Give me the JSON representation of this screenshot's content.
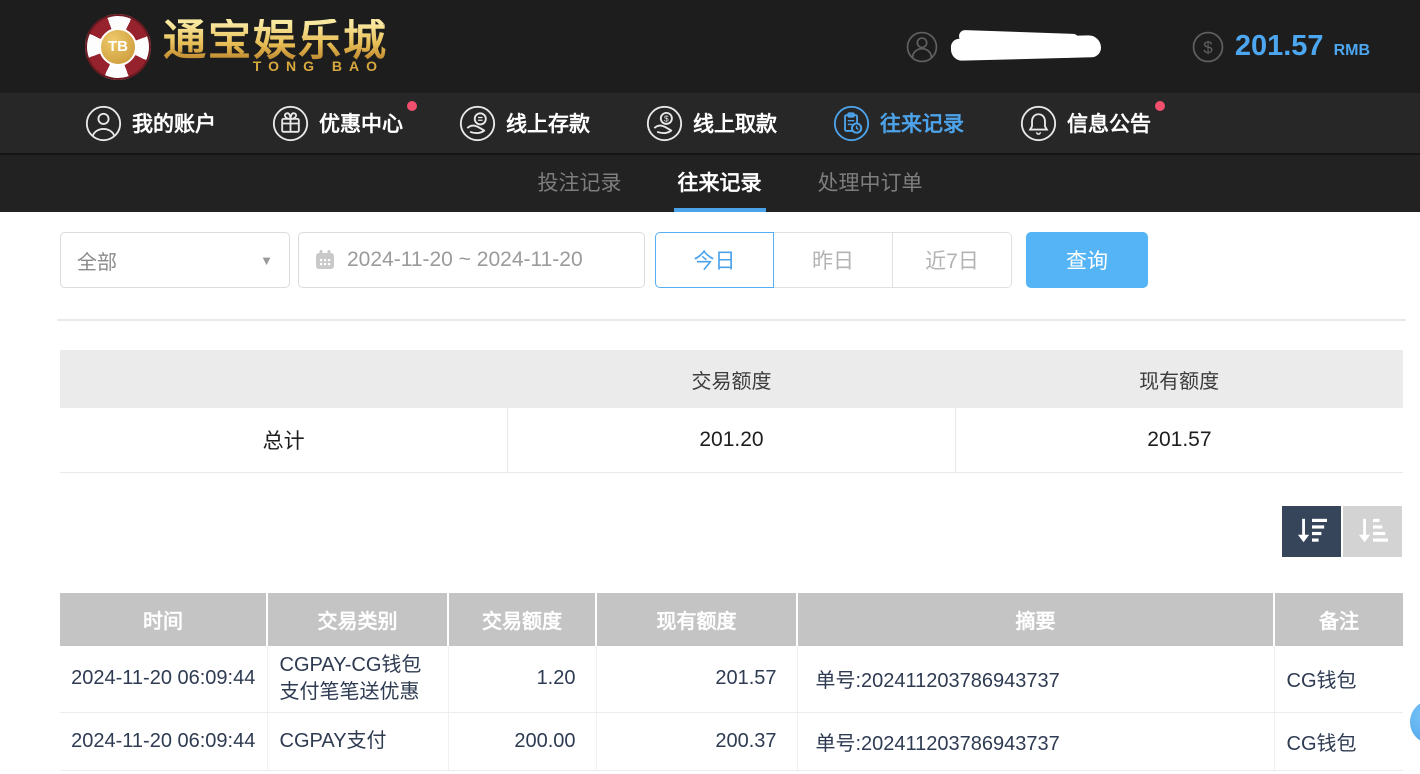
{
  "colors": {
    "accent_blue": "#4da3ea",
    "query_button_blue": "#55b4f5",
    "notification_dot": "#f04f6e",
    "sort_active_bg": "#36455a",
    "header_bg": "#1d1d1d",
    "table_header_bg": "#c4c4c4",
    "gold": "#e7bd55"
  },
  "header": {
    "logo": {
      "chip_text": "TB",
      "title_cn": "通宝娱乐城",
      "title_en": "TONG BAO"
    },
    "balance": {
      "amount": "201.57",
      "currency": "RMB"
    }
  },
  "nav": {
    "items": [
      {
        "label": "我的账户",
        "icon": "user-icon",
        "active": false,
        "dot": false
      },
      {
        "label": "优惠中心",
        "icon": "gift-icon",
        "active": false,
        "dot": true
      },
      {
        "label": "线上存款",
        "icon": "deposit-hand-coin-icon",
        "active": false,
        "dot": false
      },
      {
        "label": "线上取款",
        "icon": "withdraw-hand-coin-icon",
        "active": false,
        "dot": false
      },
      {
        "label": "往来记录",
        "icon": "records-clipboard-clock-icon",
        "active": true,
        "dot": false
      },
      {
        "label": "信息公告",
        "icon": "bell-icon",
        "active": false,
        "dot": true
      }
    ]
  },
  "tabs": {
    "items": [
      {
        "label": "投注记录",
        "active": false
      },
      {
        "label": "往来记录",
        "active": true
      },
      {
        "label": "处理中订单",
        "active": false
      }
    ]
  },
  "filters": {
    "type_select": {
      "value": "全部"
    },
    "date_range": {
      "value": "2024-11-20 ~ 2024-11-20"
    },
    "quick_ranges": {
      "today": "今日",
      "yesterday": "昨日",
      "last7": "近7日"
    },
    "query_label": "查询"
  },
  "summary_table": {
    "columns": {
      "c0": "",
      "c1": "交易额度",
      "c2": "现有额度"
    },
    "total_row": {
      "label": "总计",
      "transaction_amount": "201.20",
      "current_amount": "201.57"
    }
  },
  "records_table": {
    "columns": {
      "time": "时间",
      "type": "交易类别",
      "amount": "交易额度",
      "balance": "现有额度",
      "summary": "摘要",
      "note": "备注"
    },
    "rows": [
      {
        "time": "2024-11-20 06:09:44",
        "type": "CGPAY-CG钱包支付笔笔送优惠",
        "amount": "1.20",
        "balance": "201.57",
        "summary": "单号:202411203786943737",
        "note": "CG钱包"
      },
      {
        "time": "2024-11-20 06:09:44",
        "type": "CGPAY支付",
        "amount": "200.00",
        "balance": "200.37",
        "summary": "单号:202411203786943737",
        "note": "CG钱包"
      }
    ]
  }
}
